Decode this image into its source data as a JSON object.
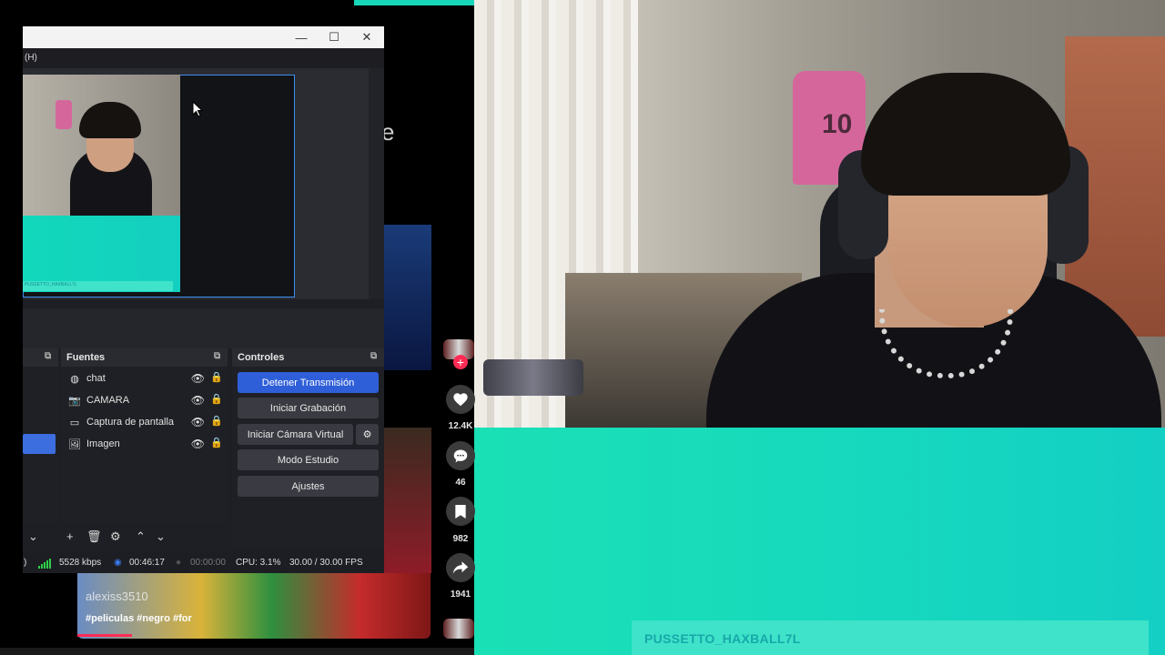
{
  "obs": {
    "menu_partial": "(H)",
    "window_controls": {
      "minimize": "—",
      "maximize": "☐",
      "close": "✕"
    },
    "docks": {
      "sources_title": "Fuentes",
      "controls_title": "Controles"
    },
    "sources": [
      {
        "icon": "chat-globe-icon",
        "name": "chat"
      },
      {
        "icon": "camera-icon",
        "name": "CAMARA"
      },
      {
        "icon": "monitor-icon",
        "name": "Captura de pantalla"
      },
      {
        "icon": "image-icon",
        "name": "Imagen"
      }
    ],
    "controls": {
      "stream": "Detener Transmisión",
      "record": "Iniciar Grabación",
      "virtual_cam": "Iniciar Cámara Virtual",
      "studio_mode": "Modo Estudio",
      "settings": "Ajustes"
    },
    "status": {
      "prefix": ")",
      "bitrate": "5528 kbps",
      "stream_time": "00:46:17",
      "record_time": "00:00:00",
      "cpu": "CPU: 3.1%",
      "fps": "30.00 / 30.00 FPS"
    }
  },
  "overlay": {
    "teal_name": "PUSSETTO_HAXBALL7L"
  },
  "tiktok": {
    "partial_text": "e",
    "likes": "12.4K",
    "comments": "46",
    "saves": "982",
    "shares": "1941",
    "video_user": "alexiss3510",
    "video_tags": "#peliculas #negro #for"
  },
  "webcam": {
    "shirt_number": "10"
  },
  "colors": {
    "accent_blue": "#2f5fd8",
    "teal": "#1ae0b5",
    "tiktok_red": "#fe2c55"
  }
}
